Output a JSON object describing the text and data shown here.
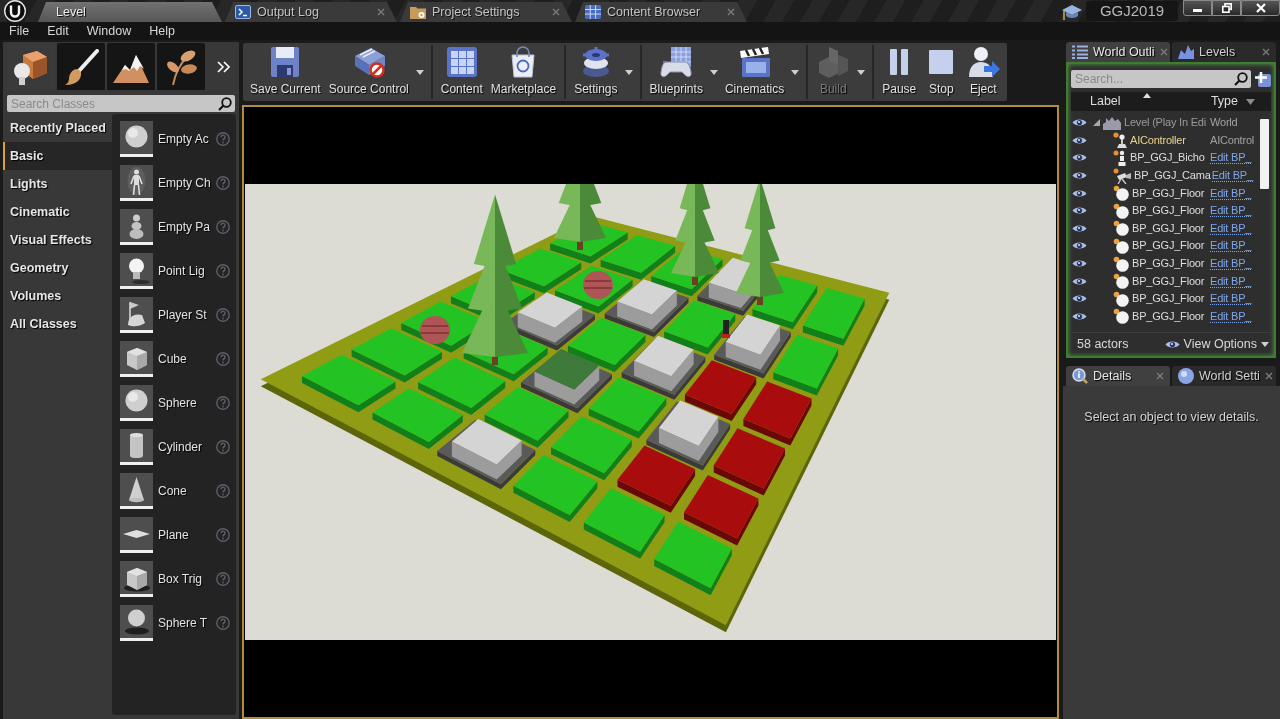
{
  "title_bar": {
    "tabs": [
      {
        "label": "Level",
        "selected": true,
        "closable": false
      },
      {
        "label": "Output Log",
        "selected": false,
        "closable": true
      },
      {
        "label": "Project Settings",
        "selected": false,
        "closable": true
      },
      {
        "label": "Content Browser",
        "selected": false,
        "closable": true
      }
    ],
    "project": "GGJ2019"
  },
  "menu_bar": [
    "File",
    "Edit",
    "Window",
    "Help"
  ],
  "modes_panel": {
    "mode_tabs": [
      {
        "selected": true
      },
      {
        "selected": false
      },
      {
        "selected": false
      },
      {
        "selected": false
      }
    ],
    "search": {
      "placeholder": "Search Classes"
    },
    "categories": [
      {
        "label": "Recently Placed",
        "selected": false
      },
      {
        "label": "Basic",
        "selected": true
      },
      {
        "label": "Lights",
        "selected": false
      },
      {
        "label": "Cinematic",
        "selected": false
      },
      {
        "label": "Visual Effects",
        "selected": false
      },
      {
        "label": "Geometry",
        "selected": false
      },
      {
        "label": "Volumes",
        "selected": false
      },
      {
        "label": "All Classes",
        "selected": false
      }
    ],
    "items": [
      {
        "label": "Empty Ac"
      },
      {
        "label": "Empty Ch"
      },
      {
        "label": "Empty Pa"
      },
      {
        "label": "Point Lig"
      },
      {
        "label": "Player St"
      },
      {
        "label": "Cube"
      },
      {
        "label": "Sphere"
      },
      {
        "label": "Cylinder"
      },
      {
        "label": "Cone"
      },
      {
        "label": "Plane"
      },
      {
        "label": "Box Trig"
      },
      {
        "label": "Sphere T"
      }
    ]
  },
  "toolbar": [
    [
      {
        "label": "Save Current",
        "dropdown": false,
        "disabled": false
      },
      {
        "label": "Source Control",
        "dropdown": true,
        "disabled": false
      }
    ],
    [
      {
        "label": "Content",
        "dropdown": false,
        "disabled": false
      },
      {
        "label": "Marketplace",
        "dropdown": false,
        "disabled": false
      }
    ],
    [
      {
        "label": "Settings",
        "dropdown": true,
        "disabled": false
      }
    ],
    [
      {
        "label": "Blueprints",
        "dropdown": true,
        "disabled": false
      },
      {
        "label": "Cinematics",
        "dropdown": true,
        "disabled": false
      }
    ],
    [
      {
        "label": "Build",
        "dropdown": true,
        "disabled": true
      }
    ],
    [
      {
        "label": "Pause",
        "dropdown": false,
        "disabled": false
      },
      {
        "label": "Stop",
        "dropdown": false,
        "disabled": false
      },
      {
        "label": "Eject",
        "dropdown": false,
        "disabled": false
      }
    ]
  ],
  "outliner": {
    "tabs": [
      {
        "label": "World Outli",
        "selected": true
      },
      {
        "label": "Levels",
        "selected": false
      }
    ],
    "search": {
      "placeholder": "Search..."
    },
    "columns": [
      "Label",
      "Type"
    ],
    "rows": [
      {
        "label": "Level (Play In Edi",
        "type": "World",
        "type_link": false,
        "visible": true,
        "expanded": true,
        "color": "#9a9a9a",
        "children": [
          {
            "label": "AIController",
            "type": "AIControl",
            "type_link": false,
            "visible": true,
            "color": "#e8d48c"
          },
          {
            "label": "BP_GGJ_Bicho",
            "type": "Edit BP_",
            "type_link": true,
            "visible": true,
            "color": "#dedede"
          },
          {
            "label": "BP_GGJ_Cama",
            "type": "Edit BP_",
            "type_link": true,
            "visible": true,
            "color": "#dedede"
          },
          {
            "label": "BP_GGJ_Floor",
            "type": "Edit BP_",
            "type_link": true,
            "visible": true,
            "color": "#dedede"
          },
          {
            "label": "BP_GGJ_Floor",
            "type": "Edit BP_",
            "type_link": true,
            "visible": true,
            "color": "#dedede"
          },
          {
            "label": "BP_GGJ_Floor",
            "type": "Edit BP_",
            "type_link": true,
            "visible": true,
            "color": "#dedede"
          },
          {
            "label": "BP_GGJ_Floor",
            "type": "Edit BP_",
            "type_link": true,
            "visible": true,
            "color": "#dedede"
          },
          {
            "label": "BP_GGJ_Floor",
            "type": "Edit BP_",
            "type_link": true,
            "visible": true,
            "color": "#dedede"
          },
          {
            "label": "BP_GGJ_Floor",
            "type": "Edit BP_",
            "type_link": true,
            "visible": true,
            "color": "#dedede"
          },
          {
            "label": "BP_GGJ_Floor",
            "type": "Edit BP_",
            "type_link": true,
            "visible": true,
            "color": "#dedede"
          },
          {
            "label": "BP_GGJ_Floor",
            "type": "Edit BP_",
            "type_link": true,
            "visible": true,
            "color": "#dedede"
          }
        ]
      }
    ],
    "actor_count": "58 actors",
    "view_options": "View Options"
  },
  "details": {
    "tabs": [
      {
        "label": "Details",
        "selected": true
      },
      {
        "label": "World Setti",
        "selected": false
      }
    ],
    "message": "Select an object to view details."
  }
}
